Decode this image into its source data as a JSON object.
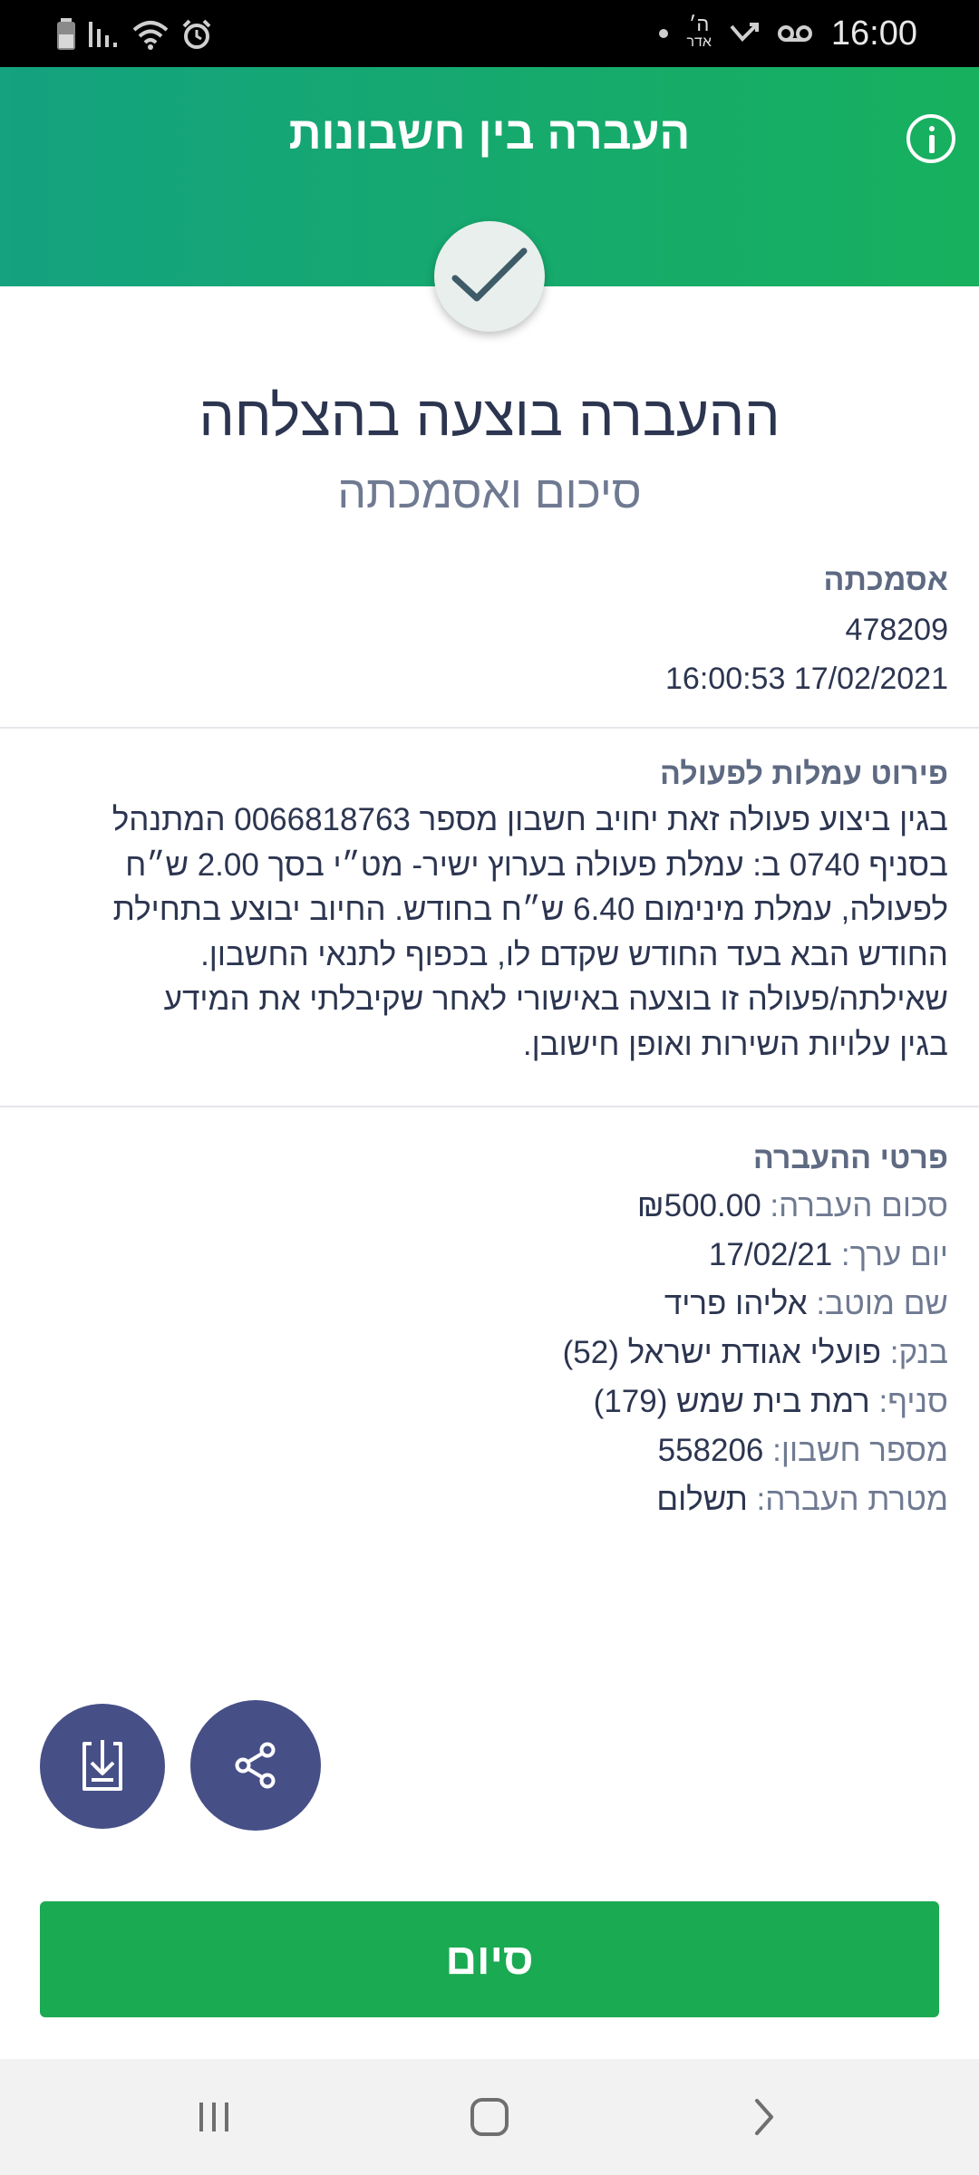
{
  "status_bar": {
    "time": "16:00",
    "hebrew_date": [
      "ה׳",
      "אדר"
    ],
    "left_icons": [
      "battery-icon",
      "signal-icon",
      "wifi-icon",
      "alarm-icon"
    ],
    "right_icons": [
      "notification-dot-icon",
      "missed-call-icon",
      "voicemail-icon"
    ]
  },
  "header": {
    "title": "העברה בין חשבונות",
    "info_icon": "info-icon",
    "colors": {
      "gradient_start": "#14a27f",
      "gradient_end": "#17b05e"
    }
  },
  "result": {
    "icon": "checkmark-icon",
    "title": "ההעברה בוצעה בהצלחה",
    "subtitle": "סיכום ואסמכתה"
  },
  "reference": {
    "heading": "אסמכתה",
    "number": "478209",
    "datetime": "17/02/2021 16:00:53"
  },
  "fees": {
    "heading": "פירוט עמלות לפעולה",
    "lines": [
      "בגין ביצוע פעולה זאת יחויב חשבון מספר 0066818763 המתנהל",
      "בסניף 0740 ב: עמלת פעולה בערוץ ישיר- מט״י בסך 2.00 ש״ח",
      "לפעולה, עמלת מינימום 6.40 ש״ח בחודש. החיוב יבוצע בתחילת",
      "החודש הבא בעד החודש שקדם לו, בכפוף לתנאי החשבון.",
      "שאילתה/פעולה זו בוצעה באישורי לאחר שקיבלתי את המידע",
      "בגין עלויות השירות ואופן חישובן."
    ]
  },
  "details": {
    "heading": "פרטי ההעברה",
    "rows": [
      {
        "label": "סכום העברה:",
        "value": "₪500.00"
      },
      {
        "label": "יום ערך:",
        "value": "17/02/21"
      },
      {
        "label": "שם מוטב:",
        "value": "אליהו פריד"
      },
      {
        "label": "בנק:",
        "value": "פועלי אגודת ישראל (52)"
      },
      {
        "label": "סניף:",
        "value": "רמת בית שמש (179)"
      },
      {
        "label": "מספר חשבון:",
        "value": "558206"
      },
      {
        "label": "מטרת העברה:",
        "value": "תשלום"
      }
    ]
  },
  "actions": {
    "download_icon": "download-document-icon",
    "share_icon": "share-icon",
    "finish_label": "סיום",
    "colors": {
      "circle": "#464f86",
      "finish": "#1aaa52"
    }
  },
  "nav": {
    "recents_icon": "recent-apps-icon",
    "home_icon": "home-icon",
    "back_icon": "back-icon"
  }
}
